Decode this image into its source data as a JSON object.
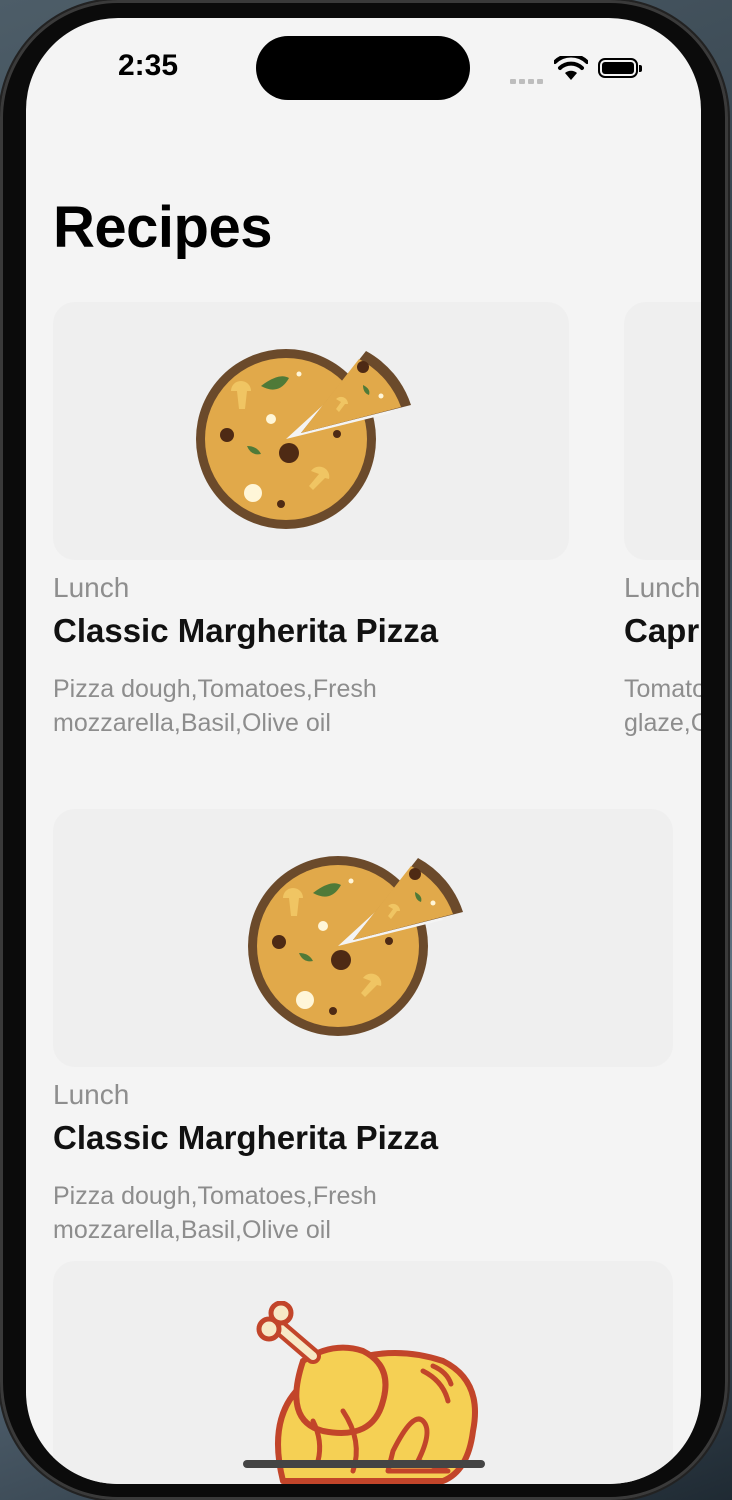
{
  "status_bar": {
    "time": "2:35"
  },
  "page": {
    "title": "Recipes"
  },
  "recipes": [
    {
      "category": "Lunch",
      "name": "Classic Margherita Pizza",
      "ingredients_line1": "Pizza dough,Tomatoes,Fresh",
      "ingredients_line2": "mozzarella,Basil,Olive oil",
      "image_icon": "pizza-icon"
    },
    {
      "category": "Lunch",
      "name": "Capr",
      "ingredients_line1": "Tomato",
      "ingredients_line2": "glaze,C",
      "image_icon": "salad-icon"
    },
    {
      "category": "Lunch",
      "name": "Classic Margherita Pizza",
      "ingredients_line1": "Pizza dough,Tomatoes,Fresh",
      "ingredients_line2": "mozzarella,Basil,Olive oil",
      "image_icon": "pizza-icon"
    },
    {
      "category": "",
      "name": "",
      "ingredients_line1": "",
      "ingredients_line2": "",
      "image_icon": "roast-chicken-icon"
    }
  ],
  "colors": {
    "screen_bg": "#f4f4f4",
    "card_bg": "#efefef",
    "category_text": "#8e8e8e",
    "pizza_crust": "#6b4a2b",
    "pizza_cheese": "#e1a94a",
    "chicken_body": "#f5d054",
    "chicken_outline": "#c2452a"
  }
}
